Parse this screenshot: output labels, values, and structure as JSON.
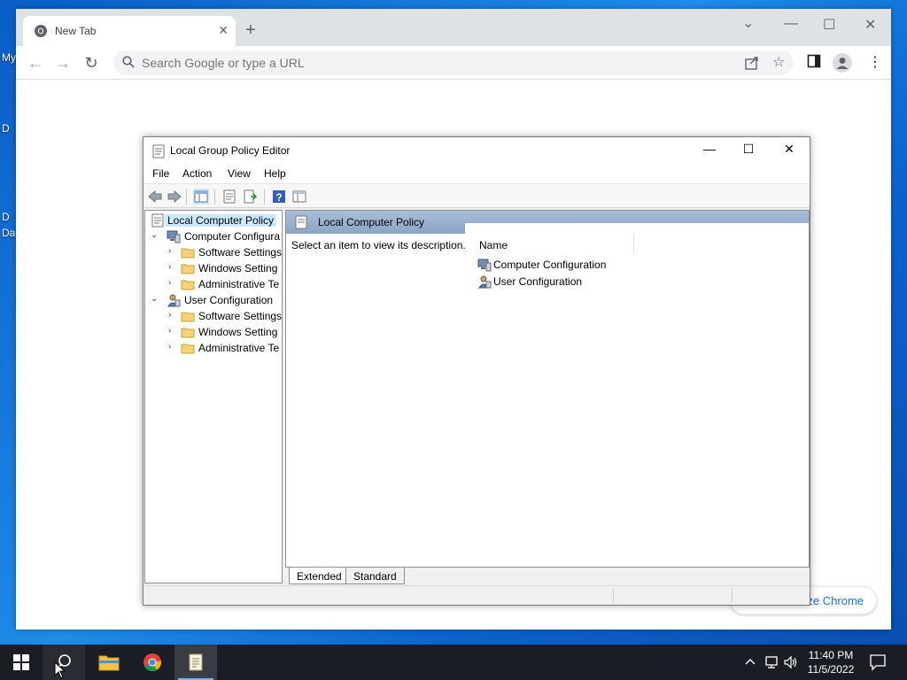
{
  "desktop": {
    "labels": [
      "My",
      "D",
      "Da"
    ]
  },
  "chrome": {
    "tab_title": "New Tab",
    "tab_close": "✕",
    "new_tab": "+",
    "omnibox_placeholder": "Search Google or type a URL",
    "customize_label": "ize Chrome",
    "window_controls": {
      "minimize": "—",
      "maximize": "☐",
      "close": "✕",
      "tab_search": "⌄"
    }
  },
  "gpe": {
    "title": "Local Group Policy Editor",
    "menu": [
      "File",
      "Action",
      "View",
      "Help"
    ],
    "tree": [
      {
        "label": "Local Computer Policy",
        "level": 0,
        "selected": true
      },
      {
        "label": "Computer Configura",
        "level": 1,
        "arrow": "⌄"
      },
      {
        "label": "Software Settings",
        "level": 2,
        "arrow": "›"
      },
      {
        "label": "Windows Setting",
        "level": 2,
        "arrow": "›"
      },
      {
        "label": "Administrative Te",
        "level": 2,
        "arrow": "›"
      },
      {
        "label": "User Configuration",
        "level": 1,
        "arrow": "⌄"
      },
      {
        "label": "Software Settings",
        "level": 2,
        "arrow": "›"
      },
      {
        "label": "Windows Setting",
        "level": 2,
        "arrow": "›"
      },
      {
        "label": "Administrative Te",
        "level": 2,
        "arrow": "›"
      }
    ],
    "right_header": "Local Computer Policy",
    "description": "Select an item to view its description.",
    "list_column": "Name",
    "list_items": [
      "Computer Configuration",
      "User Configuration"
    ],
    "bottom_tabs": [
      "Extended",
      "Standard"
    ],
    "scroll_left": "<",
    "scroll_right": ">"
  },
  "taskbar": {
    "time": "11:40 PM",
    "date": "11/5/2022"
  },
  "colors": {
    "desktop": "#1a78d6",
    "taskbar": "#1b1d24",
    "selection": "#cce8ff",
    "panel_header": "#98b1cf",
    "link": "#1a73e8"
  }
}
